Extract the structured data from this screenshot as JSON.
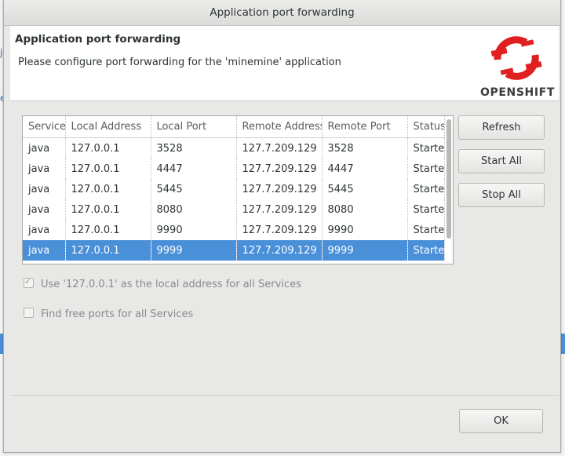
{
  "dialog": {
    "window_title": "Application port forwarding",
    "header_title": "Application port forwarding",
    "header_description": "Please configure port forwarding for the 'minemine' application",
    "logo_text": "OPENSHIFT"
  },
  "table": {
    "columns": [
      "Service",
      "Local Address",
      "Local Port",
      "Remote Address",
      "Remote Port",
      "Status"
    ],
    "rows": [
      [
        "java",
        "127.0.0.1",
        "3528",
        "127.7.209.129",
        "3528",
        "Started"
      ],
      [
        "java",
        "127.0.0.1",
        "4447",
        "127.7.209.129",
        "4447",
        "Started"
      ],
      [
        "java",
        "127.0.0.1",
        "5445",
        "127.7.209.129",
        "5445",
        "Started"
      ],
      [
        "java",
        "127.0.0.1",
        "8080",
        "127.7.209.129",
        "8080",
        "Started"
      ],
      [
        "java",
        "127.0.0.1",
        "9990",
        "127.7.209.129",
        "9990",
        "Started"
      ],
      [
        "java",
        "127.0.0.1",
        "9999",
        "127.7.209.129",
        "9999",
        "Started"
      ]
    ],
    "selected_row_index": 5
  },
  "buttons": {
    "refresh": "Refresh",
    "start_all": "Start All",
    "stop_all": "Stop All",
    "ok": "OK"
  },
  "options": {
    "use_localhost_label": "Use '127.0.0.1' as the local address for all Services",
    "use_localhost_checked": true,
    "find_free_ports_label": "Find free ports for all Services",
    "find_free_ports_checked": false
  },
  "colors": {
    "selection": "#4a90d9",
    "logo_red": "#e02020"
  }
}
